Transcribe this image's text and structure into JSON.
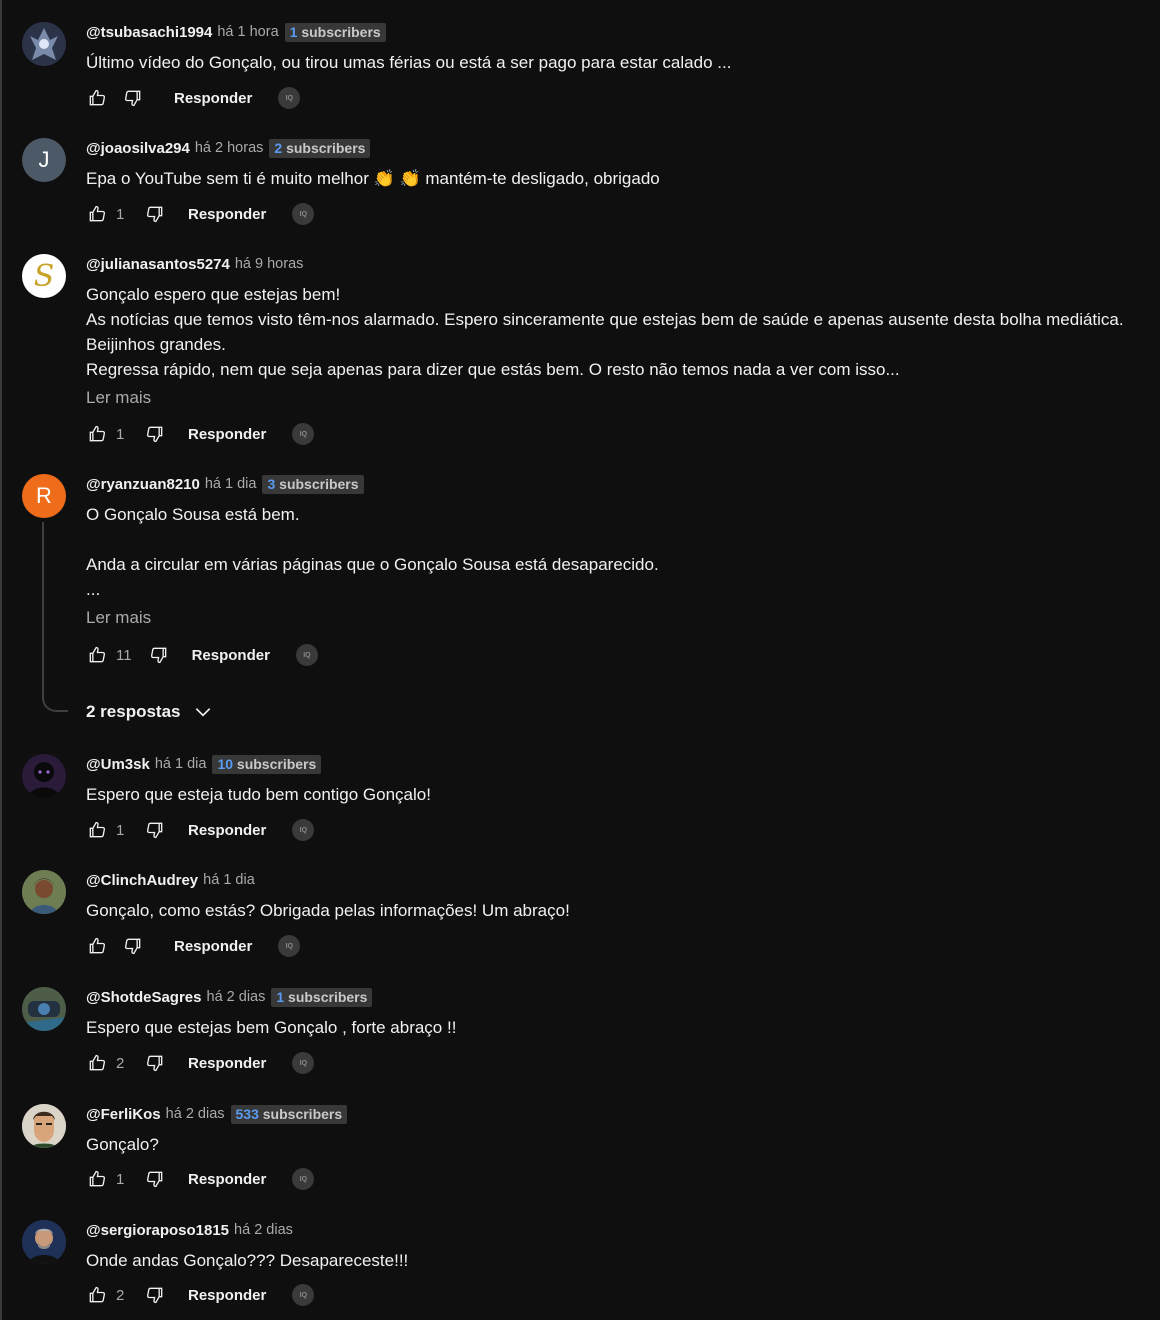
{
  "comments": [
    {
      "author": "@tsubasachi1994",
      "time": "há 1 hora",
      "badge_num": "1",
      "badge_label": "subscribers",
      "text": "Último vídeo do Gonçalo, ou tirou umas férias ou está a ser pago para estar calado ...",
      "likes": "",
      "reply": "Responder",
      "iq": "IQ"
    },
    {
      "author": "@joaosilva294",
      "time": "há 2 horas",
      "badge_num": "2",
      "badge_label": "subscribers",
      "text": "Epa o YouTube sem ti é muito melhor 👏 👏 mantém-te desligado, obrigado",
      "likes": "1",
      "reply": "Responder",
      "iq": "IQ",
      "avatar_letter": "J"
    },
    {
      "author": "@julianasantos5274",
      "time": "há 9 horas",
      "text": "Gonçalo espero que estejas bem!\nAs notícias que temos visto têm-nos alarmado. Espero sinceramente que estejas bem de saúde e apenas ausente desta bolha mediática.\nBeijinhos grandes.\nRegressa rápido, nem que seja apenas para dizer que estás bem. O resto não  temos nada a ver com isso...",
      "more": "Ler mais",
      "likes": "1",
      "reply": "Responder",
      "iq": "IQ",
      "avatar_letter": "S"
    },
    {
      "author": "@ryanzuan8210",
      "time": "há 1 dia",
      "badge_num": "3",
      "badge_label": "subscribers",
      "text": "O Gonçalo Sousa está bem.\n\nAnda a circular em várias páginas que o Gonçalo Sousa está desaparecido.\n...",
      "more": "Ler mais",
      "likes": "11",
      "reply": "Responder",
      "iq": "IQ",
      "avatar_letter": "R",
      "replies_label": "2 respostas"
    },
    {
      "author": "@Um3sk",
      "time": "há 1 dia",
      "badge_num": "10",
      "badge_label": "subscribers",
      "text": "Espero que esteja tudo bem contigo Gonçalo!",
      "likes": "1",
      "reply": "Responder",
      "iq": "IQ"
    },
    {
      "author": "@ClinchAudrey",
      "time": "há 1 dia",
      "text": "Gonçalo, como estás? Obrigada pelas informações! Um abraço!",
      "likes": "",
      "reply": "Responder",
      "iq": "IQ"
    },
    {
      "author": "@ShotdeSagres",
      "time": "há 2 dias",
      "badge_num": "1",
      "badge_label": "subscribers",
      "text": "Espero que estejas bem Gonçalo , forte abraço !!",
      "likes": "2",
      "reply": "Responder",
      "iq": "IQ"
    },
    {
      "author": "@FerliKos",
      "time": "há 2 dias",
      "badge_num": "533",
      "badge_label": "subscribers",
      "text": "Gonçalo?",
      "likes": "1",
      "reply": "Responder",
      "iq": "IQ"
    },
    {
      "author": "@sergioraposo1815",
      "time": "há 2 dias",
      "text": "Onde andas Gonçalo??? Desapareceste!!!",
      "likes": "2",
      "reply": "Responder",
      "iq": "IQ"
    }
  ],
  "colors": {
    "background": "#0f0f0f",
    "badge_number": "#5a9bf0",
    "avatar_j": "#4b5a66",
    "avatar_r": "#ef6c1a"
  },
  "icons": [
    "thumb-up-icon",
    "thumb-down-icon",
    "chevron-down-icon",
    "iq-icon"
  ]
}
